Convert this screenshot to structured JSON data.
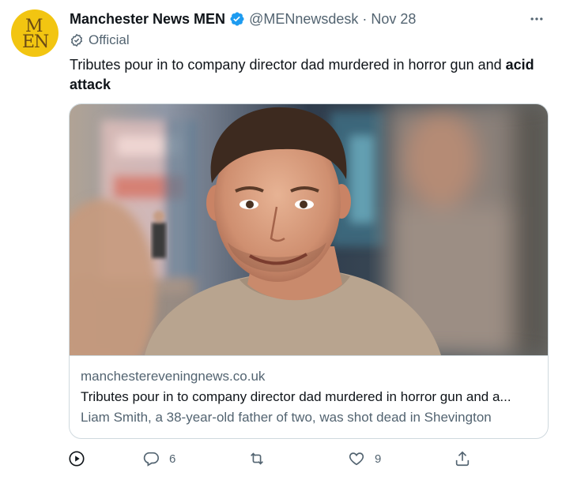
{
  "author": {
    "avatar_text_top": "M",
    "avatar_text_bottom": "EN",
    "name": "Manchester News MEN",
    "handle": "@MENnewsdesk",
    "separator": "·",
    "date": "Nov 28",
    "label": "Official"
  },
  "tweet": {
    "text_plain": "Tributes pour in to company director dad murdered in horror gun and ",
    "text_bold": "acid attack"
  },
  "card": {
    "domain": "manchestereveningnews.co.uk",
    "title": "Tributes pour in to company director dad murdered in horror gun and a...",
    "description": "Liam Smith, a 38-year-old father of two, was shot dead in Shevington"
  },
  "actions": {
    "replies": "6",
    "likes": "9"
  },
  "icons": {
    "verified": "verified-badge-icon",
    "more": "more-icon",
    "official": "official-check-icon",
    "view": "play-icon",
    "reply": "reply-icon",
    "retweet": "retweet-icon",
    "like": "heart-icon",
    "share": "share-icon"
  },
  "colors": {
    "accent": "#1d9bf0",
    "muted": "#536471",
    "text": "#0f1419",
    "avatar_bg": "#f2c511"
  }
}
